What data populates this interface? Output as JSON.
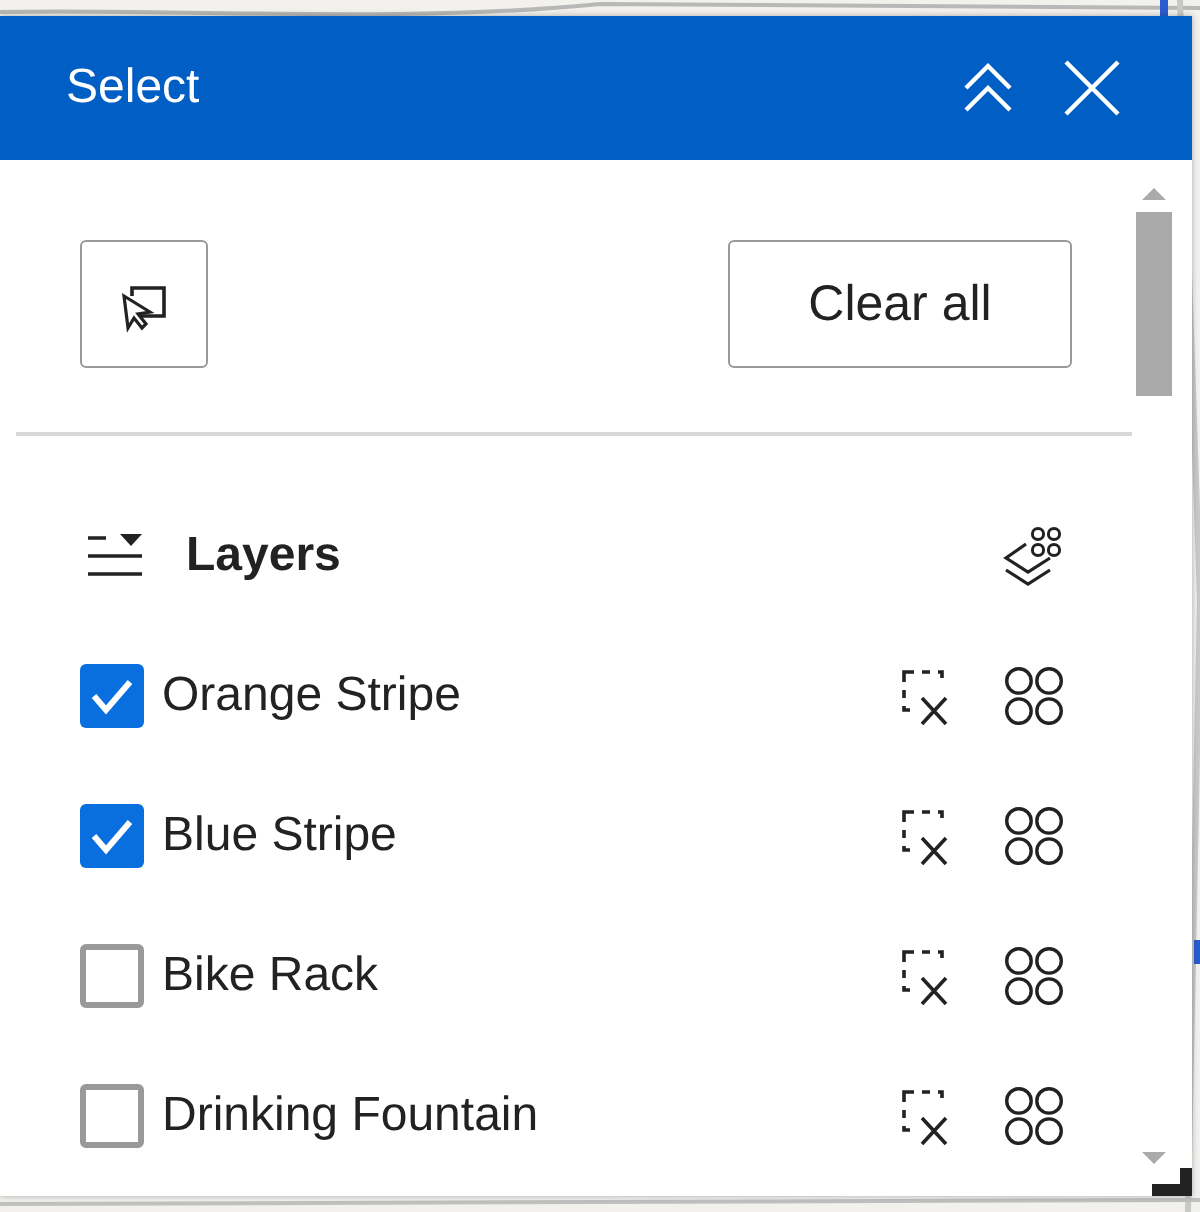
{
  "panel": {
    "title": "Select"
  },
  "toolbar": {
    "clear_label": "Clear all"
  },
  "layers_section": {
    "heading": "Layers"
  },
  "layers": [
    {
      "label": "Orange Stripe",
      "checked": true
    },
    {
      "label": "Blue Stripe",
      "checked": true
    },
    {
      "label": "Bike Rack",
      "checked": false
    },
    {
      "label": "Drinking Fountain",
      "checked": false
    }
  ]
}
